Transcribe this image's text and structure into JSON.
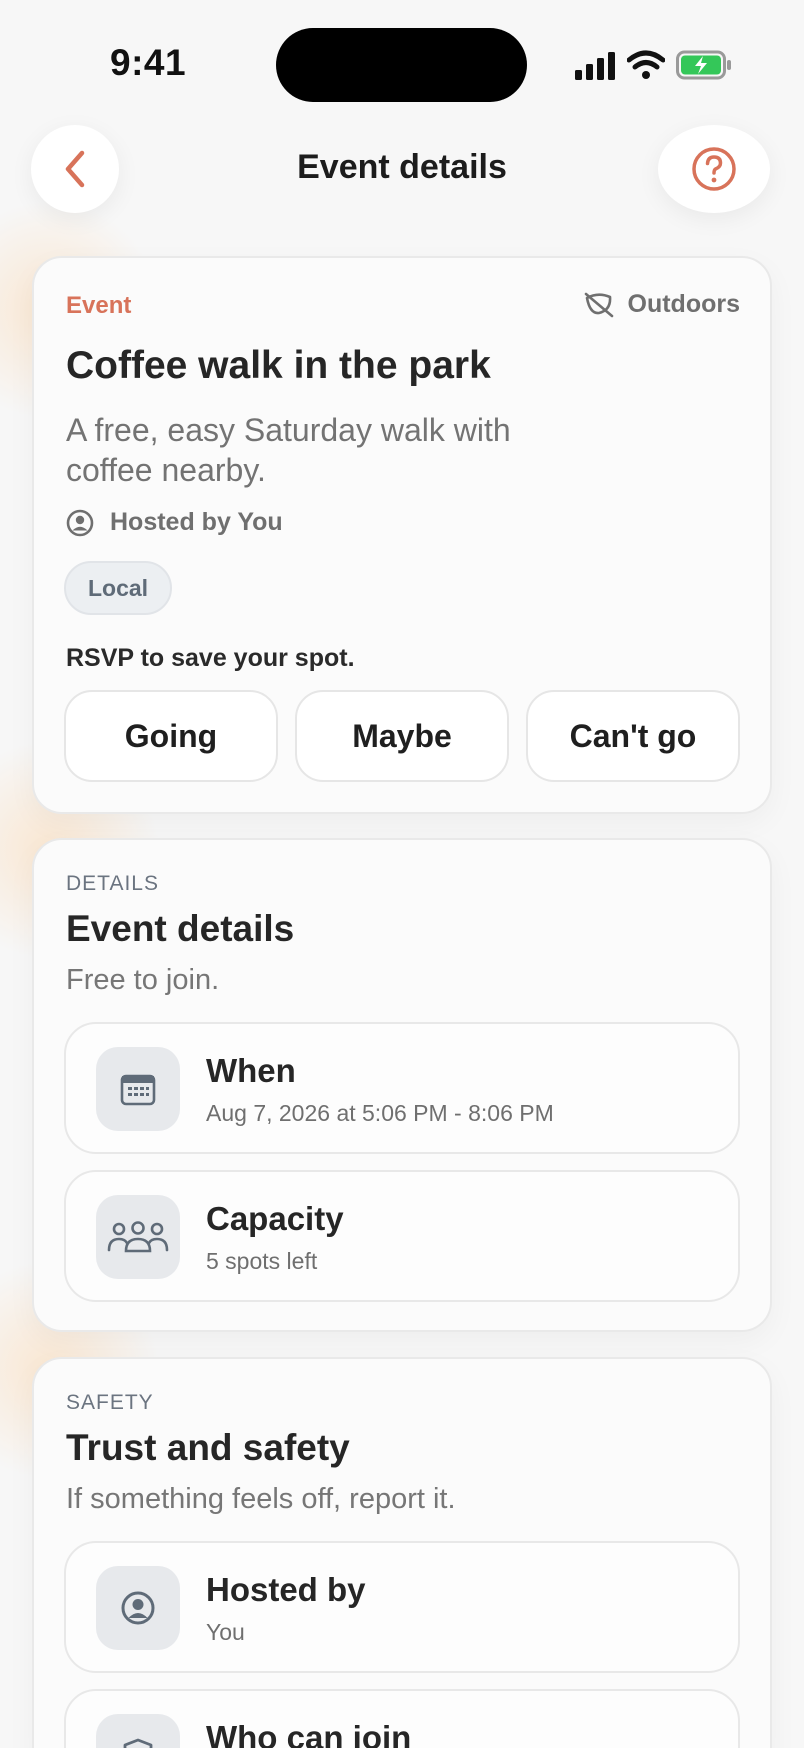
{
  "status_bar": {
    "time": "9:41"
  },
  "header": {
    "title": "Event details"
  },
  "event_card": {
    "label": "Event",
    "category": "Outdoors",
    "title": "Coffee walk in the park",
    "description": "A free, easy Saturday walk with coffee nearby.",
    "host": "Hosted by You",
    "tag": "Local",
    "rsvp_prompt": "RSVP to save your spot.",
    "rsvp_options": [
      "Going",
      "Maybe",
      "Can't go"
    ]
  },
  "details_section": {
    "eyebrow": "DETAILS",
    "title": "Event details",
    "subtitle": "Free to join.",
    "rows": [
      {
        "title": "When",
        "subtitle": "Aug 7, 2026 at 5:06 PM - 8:06 PM",
        "icon": "calendar-icon"
      },
      {
        "title": "Capacity",
        "subtitle": "5 spots left",
        "icon": "people-icon"
      }
    ]
  },
  "safety_section": {
    "eyebrow": "SAFETY",
    "title": "Trust and safety",
    "subtitle": "If something feels off, report it.",
    "rows": [
      {
        "title": "Hosted by",
        "subtitle": "You",
        "icon": "user-circle-icon"
      },
      {
        "title": "Who can join",
        "subtitle": "",
        "icon": "shield-icon"
      }
    ]
  },
  "colors": {
    "accent": "#d8735a",
    "background": "#f7f7f7",
    "battery": "#34c759"
  }
}
